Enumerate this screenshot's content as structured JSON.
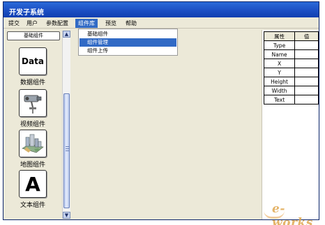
{
  "window": {
    "title": "开发子系统"
  },
  "menubar": {
    "items": [
      "提交",
      "用户",
      "参数配置",
      "组件库",
      "预览",
      "帮助"
    ],
    "active": "组件库"
  },
  "dropdown": {
    "options": [
      "基础组件",
      "组件管理",
      "组件上传"
    ],
    "selected": "组件管理"
  },
  "left_panel": {
    "category_button": "基础组件",
    "components": [
      {
        "label": "数据组件",
        "icon": "data-icon",
        "icon_text": "Data"
      },
      {
        "label": "视频组件",
        "icon": "camera-icon"
      },
      {
        "label": "地图组件",
        "icon": "map-icon"
      },
      {
        "label": "文本组件",
        "icon": "text-icon",
        "icon_text": "A"
      }
    ],
    "scroll_up": "▲",
    "scroll_down": "▼"
  },
  "properties": {
    "header_name": "属性",
    "header_value": "值",
    "rows": [
      {
        "name": "Type",
        "value": ""
      },
      {
        "name": "Name",
        "value": ""
      },
      {
        "name": "X",
        "value": ""
      },
      {
        "name": "Y",
        "value": ""
      },
      {
        "name": "Height",
        "value": ""
      },
      {
        "name": "Width",
        "value": ""
      },
      {
        "name": "Text",
        "value": ""
      }
    ]
  },
  "watermark": {
    "text": "e-works"
  },
  "colors": {
    "titlebar": "#1c4fc4",
    "menu_active": "#316ac5",
    "panel_bg": "#ece9d8"
  }
}
